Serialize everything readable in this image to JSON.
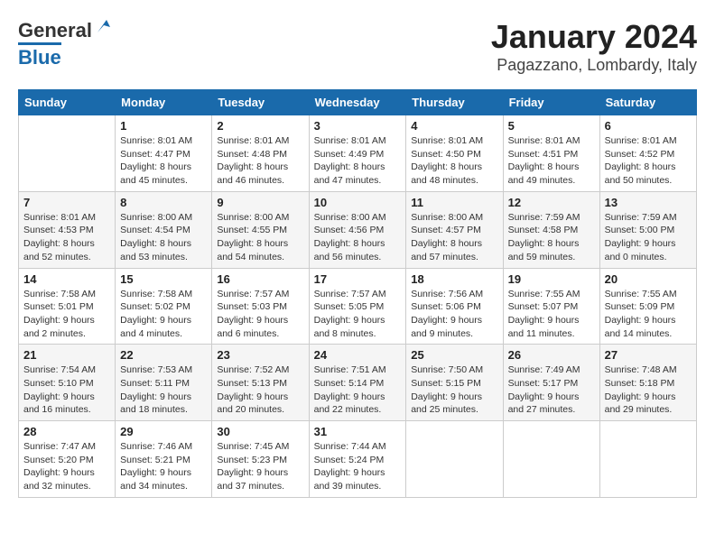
{
  "header": {
    "logo_general": "General",
    "logo_blue": "Blue",
    "title": "January 2024",
    "subtitle": "Pagazzano, Lombardy, Italy"
  },
  "columns": [
    "Sunday",
    "Monday",
    "Tuesday",
    "Wednesday",
    "Thursday",
    "Friday",
    "Saturday"
  ],
  "weeks": [
    [
      {
        "day": "",
        "info": ""
      },
      {
        "day": "1",
        "info": "Sunrise: 8:01 AM\nSunset: 4:47 PM\nDaylight: 8 hours\nand 45 minutes."
      },
      {
        "day": "2",
        "info": "Sunrise: 8:01 AM\nSunset: 4:48 PM\nDaylight: 8 hours\nand 46 minutes."
      },
      {
        "day": "3",
        "info": "Sunrise: 8:01 AM\nSunset: 4:49 PM\nDaylight: 8 hours\nand 47 minutes."
      },
      {
        "day": "4",
        "info": "Sunrise: 8:01 AM\nSunset: 4:50 PM\nDaylight: 8 hours\nand 48 minutes."
      },
      {
        "day": "5",
        "info": "Sunrise: 8:01 AM\nSunset: 4:51 PM\nDaylight: 8 hours\nand 49 minutes."
      },
      {
        "day": "6",
        "info": "Sunrise: 8:01 AM\nSunset: 4:52 PM\nDaylight: 8 hours\nand 50 minutes."
      }
    ],
    [
      {
        "day": "7",
        "info": "Sunrise: 8:01 AM\nSunset: 4:53 PM\nDaylight: 8 hours\nand 52 minutes."
      },
      {
        "day": "8",
        "info": "Sunrise: 8:00 AM\nSunset: 4:54 PM\nDaylight: 8 hours\nand 53 minutes."
      },
      {
        "day": "9",
        "info": "Sunrise: 8:00 AM\nSunset: 4:55 PM\nDaylight: 8 hours\nand 54 minutes."
      },
      {
        "day": "10",
        "info": "Sunrise: 8:00 AM\nSunset: 4:56 PM\nDaylight: 8 hours\nand 56 minutes."
      },
      {
        "day": "11",
        "info": "Sunrise: 8:00 AM\nSunset: 4:57 PM\nDaylight: 8 hours\nand 57 minutes."
      },
      {
        "day": "12",
        "info": "Sunrise: 7:59 AM\nSunset: 4:58 PM\nDaylight: 8 hours\nand 59 minutes."
      },
      {
        "day": "13",
        "info": "Sunrise: 7:59 AM\nSunset: 5:00 PM\nDaylight: 9 hours\nand 0 minutes."
      }
    ],
    [
      {
        "day": "14",
        "info": "Sunrise: 7:58 AM\nSunset: 5:01 PM\nDaylight: 9 hours\nand 2 minutes."
      },
      {
        "day": "15",
        "info": "Sunrise: 7:58 AM\nSunset: 5:02 PM\nDaylight: 9 hours\nand 4 minutes."
      },
      {
        "day": "16",
        "info": "Sunrise: 7:57 AM\nSunset: 5:03 PM\nDaylight: 9 hours\nand 6 minutes."
      },
      {
        "day": "17",
        "info": "Sunrise: 7:57 AM\nSunset: 5:05 PM\nDaylight: 9 hours\nand 8 minutes."
      },
      {
        "day": "18",
        "info": "Sunrise: 7:56 AM\nSunset: 5:06 PM\nDaylight: 9 hours\nand 9 minutes."
      },
      {
        "day": "19",
        "info": "Sunrise: 7:55 AM\nSunset: 5:07 PM\nDaylight: 9 hours\nand 11 minutes."
      },
      {
        "day": "20",
        "info": "Sunrise: 7:55 AM\nSunset: 5:09 PM\nDaylight: 9 hours\nand 14 minutes."
      }
    ],
    [
      {
        "day": "21",
        "info": "Sunrise: 7:54 AM\nSunset: 5:10 PM\nDaylight: 9 hours\nand 16 minutes."
      },
      {
        "day": "22",
        "info": "Sunrise: 7:53 AM\nSunset: 5:11 PM\nDaylight: 9 hours\nand 18 minutes."
      },
      {
        "day": "23",
        "info": "Sunrise: 7:52 AM\nSunset: 5:13 PM\nDaylight: 9 hours\nand 20 minutes."
      },
      {
        "day": "24",
        "info": "Sunrise: 7:51 AM\nSunset: 5:14 PM\nDaylight: 9 hours\nand 22 minutes."
      },
      {
        "day": "25",
        "info": "Sunrise: 7:50 AM\nSunset: 5:15 PM\nDaylight: 9 hours\nand 25 minutes."
      },
      {
        "day": "26",
        "info": "Sunrise: 7:49 AM\nSunset: 5:17 PM\nDaylight: 9 hours\nand 27 minutes."
      },
      {
        "day": "27",
        "info": "Sunrise: 7:48 AM\nSunset: 5:18 PM\nDaylight: 9 hours\nand 29 minutes."
      }
    ],
    [
      {
        "day": "28",
        "info": "Sunrise: 7:47 AM\nSunset: 5:20 PM\nDaylight: 9 hours\nand 32 minutes."
      },
      {
        "day": "29",
        "info": "Sunrise: 7:46 AM\nSunset: 5:21 PM\nDaylight: 9 hours\nand 34 minutes."
      },
      {
        "day": "30",
        "info": "Sunrise: 7:45 AM\nSunset: 5:23 PM\nDaylight: 9 hours\nand 37 minutes."
      },
      {
        "day": "31",
        "info": "Sunrise: 7:44 AM\nSunset: 5:24 PM\nDaylight: 9 hours\nand 39 minutes."
      },
      {
        "day": "",
        "info": ""
      },
      {
        "day": "",
        "info": ""
      },
      {
        "day": "",
        "info": ""
      }
    ]
  ]
}
